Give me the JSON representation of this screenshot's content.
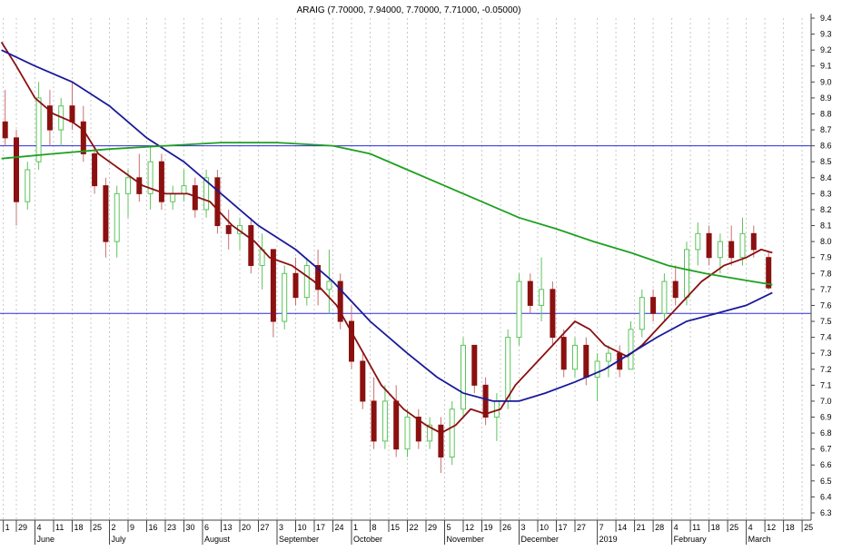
{
  "chart_data": {
    "type": "candlestick",
    "title": "ARAIG (7.70000, 7.94000, 7.70000, 7.71000, -0.05000)",
    "ylim": [
      6.3,
      9.4
    ],
    "y_ticks": [
      6.3,
      6.4,
      6.5,
      6.6,
      6.7,
      6.8,
      6.9,
      7.0,
      7.1,
      7.2,
      7.3,
      7.4,
      7.5,
      7.6,
      7.7,
      7.8,
      7.9,
      8.0,
      8.1,
      8.2,
      8.3,
      8.4,
      8.5,
      8.6,
      8.7,
      8.8,
      8.9,
      9.0,
      9.1,
      9.2,
      9.3,
      9.4
    ],
    "xlim_days": [
      -4,
      213
    ],
    "x_ticks": [
      {
        "d": -3.5,
        "label": "1"
      },
      {
        "d": 0,
        "label": "29"
      },
      {
        "d": 5,
        "label": "4"
      },
      {
        "d": 10,
        "label": "11"
      },
      {
        "d": 15,
        "label": "18"
      },
      {
        "d": 20,
        "label": "25"
      },
      {
        "d": 25,
        "label": "2"
      },
      {
        "d": 30,
        "label": "9"
      },
      {
        "d": 35,
        "label": "16"
      },
      {
        "d": 40,
        "label": "23"
      },
      {
        "d": 45,
        "label": "30"
      },
      {
        "d": 50,
        "label": "6"
      },
      {
        "d": 55,
        "label": "13"
      },
      {
        "d": 60,
        "label": "20"
      },
      {
        "d": 65,
        "label": "27"
      },
      {
        "d": 70,
        "label": "3"
      },
      {
        "d": 75,
        "label": "10"
      },
      {
        "d": 80,
        "label": "17"
      },
      {
        "d": 85,
        "label": "24"
      },
      {
        "d": 90,
        "label": "1"
      },
      {
        "d": 95,
        "label": "8"
      },
      {
        "d": 100,
        "label": "15"
      },
      {
        "d": 105,
        "label": "22"
      },
      {
        "d": 110,
        "label": "29"
      },
      {
        "d": 115,
        "label": "5"
      },
      {
        "d": 120,
        "label": "12"
      },
      {
        "d": 125,
        "label": "19"
      },
      {
        "d": 130,
        "label": "26"
      },
      {
        "d": 135,
        "label": "3"
      },
      {
        "d": 140,
        "label": "10"
      },
      {
        "d": 145,
        "label": "17"
      },
      {
        "d": 150,
        "label": "27"
      },
      {
        "d": 156,
        "label": "7"
      },
      {
        "d": 161,
        "label": "14"
      },
      {
        "d": 166,
        "label": "21"
      },
      {
        "d": 171,
        "label": "28"
      },
      {
        "d": 176,
        "label": "4"
      },
      {
        "d": 181,
        "label": "11"
      },
      {
        "d": 186,
        "label": "18"
      },
      {
        "d": 191,
        "label": "25"
      },
      {
        "d": 196,
        "label": "4"
      },
      {
        "d": 201,
        "label": "12"
      },
      {
        "d": 206,
        "label": "18"
      },
      {
        "d": 211,
        "label": "25"
      }
    ],
    "months": [
      {
        "d": 5,
        "label": "June"
      },
      {
        "d": 25,
        "label": "July"
      },
      {
        "d": 50,
        "label": "August"
      },
      {
        "d": 70,
        "label": "September"
      },
      {
        "d": 90,
        "label": "October"
      },
      {
        "d": 115,
        "label": "November"
      },
      {
        "d": 135,
        "label": "December"
      },
      {
        "d": 156,
        "label": "2019"
      },
      {
        "d": 176,
        "label": "February"
      },
      {
        "d": 196,
        "label": "March"
      }
    ],
    "horizontal_lines": [
      8.6,
      7.55
    ],
    "candles": [
      [
        -3,
        8.75,
        8.95,
        8.6,
        8.65
      ],
      [
        0,
        8.65,
        8.7,
        8.1,
        8.25
      ],
      [
        3,
        8.25,
        8.5,
        8.2,
        8.45
      ],
      [
        6,
        8.5,
        9.0,
        8.45,
        8.9
      ],
      [
        9,
        8.85,
        8.95,
        8.6,
        8.7
      ],
      [
        12,
        8.7,
        8.9,
        8.6,
        8.85
      ],
      [
        15,
        8.85,
        9.0,
        8.7,
        8.75
      ],
      [
        18,
        8.75,
        8.85,
        8.5,
        8.55
      ],
      [
        21,
        8.55,
        8.6,
        8.3,
        8.35
      ],
      [
        24,
        8.35,
        8.4,
        7.9,
        8.0
      ],
      [
        27,
        8.0,
        8.35,
        7.9,
        8.3
      ],
      [
        30,
        8.3,
        8.45,
        8.15,
        8.4
      ],
      [
        33,
        8.4,
        8.55,
        8.25,
        8.3
      ],
      [
        36,
        8.3,
        8.6,
        8.2,
        8.5
      ],
      [
        39,
        8.5,
        8.55,
        8.2,
        8.25
      ],
      [
        42,
        8.25,
        8.35,
        8.2,
        8.3
      ],
      [
        45,
        8.3,
        8.45,
        8.25,
        8.35
      ],
      [
        48,
        8.35,
        8.4,
        8.15,
        8.2
      ],
      [
        51,
        8.2,
        8.45,
        8.15,
        8.4
      ],
      [
        54,
        8.4,
        8.45,
        8.05,
        8.1
      ],
      [
        57,
        8.1,
        8.2,
        7.95,
        8.05
      ],
      [
        60,
        8.05,
        8.15,
        7.95,
        8.1
      ],
      [
        63,
        8.1,
        8.15,
        7.8,
        7.85
      ],
      [
        66,
        7.85,
        8.05,
        7.7,
        7.95
      ],
      [
        69,
        7.95,
        7.95,
        7.4,
        7.5
      ],
      [
        72,
        7.5,
        7.85,
        7.45,
        7.8
      ],
      [
        75,
        7.8,
        7.9,
        7.6,
        7.65
      ],
      [
        78,
        7.65,
        7.9,
        7.6,
        7.85
      ],
      [
        81,
        7.85,
        7.95,
        7.6,
        7.7
      ],
      [
        84,
        7.7,
        7.95,
        7.55,
        7.75
      ],
      [
        87,
        7.75,
        7.8,
        7.45,
        7.5
      ],
      [
        90,
        7.5,
        7.6,
        7.2,
        7.25
      ],
      [
        93,
        7.25,
        7.3,
        6.95,
        7.0
      ],
      [
        96,
        7.0,
        7.15,
        6.7,
        6.75
      ],
      [
        99,
        6.75,
        7.1,
        6.7,
        7.0
      ],
      [
        102,
        7.0,
        7.1,
        6.65,
        6.7
      ],
      [
        105,
        6.7,
        6.95,
        6.65,
        6.9
      ],
      [
        108,
        6.9,
        6.95,
        6.7,
        6.75
      ],
      [
        111,
        6.75,
        6.9,
        6.7,
        6.85
      ],
      [
        114,
        6.85,
        6.9,
        6.55,
        6.65
      ],
      [
        117,
        6.65,
        7.0,
        6.6,
        6.95
      ],
      [
        120,
        6.95,
        7.4,
        6.9,
        7.35
      ],
      [
        123,
        7.35,
        7.35,
        7.05,
        7.1
      ],
      [
        126,
        7.1,
        7.15,
        6.85,
        6.9
      ],
      [
        129,
        6.9,
        7.05,
        6.75,
        7.0
      ],
      [
        132,
        7.0,
        7.45,
        6.95,
        7.4
      ],
      [
        135,
        7.4,
        7.8,
        7.35,
        7.75
      ],
      [
        138,
        7.75,
        7.8,
        7.55,
        7.6
      ],
      [
        141,
        7.6,
        7.9,
        7.5,
        7.7
      ],
      [
        144,
        7.7,
        7.75,
        7.35,
        7.4
      ],
      [
        147,
        7.4,
        7.45,
        7.15,
        7.2
      ],
      [
        150,
        7.2,
        7.4,
        7.15,
        7.35
      ],
      [
        153,
        7.35,
        7.4,
        7.1,
        7.15
      ],
      [
        156,
        7.15,
        7.3,
        7.0,
        7.25
      ],
      [
        159,
        7.25,
        7.35,
        7.15,
        7.3
      ],
      [
        162,
        7.3,
        7.35,
        7.15,
        7.2
      ],
      [
        165,
        7.2,
        7.5,
        7.2,
        7.45
      ],
      [
        168,
        7.45,
        7.7,
        7.4,
        7.65
      ],
      [
        171,
        7.65,
        7.7,
        7.5,
        7.55
      ],
      [
        174,
        7.55,
        7.8,
        7.5,
        7.75
      ],
      [
        177,
        7.75,
        7.85,
        7.6,
        7.65
      ],
      [
        180,
        7.65,
        8.0,
        7.6,
        7.95
      ],
      [
        183,
        7.95,
        8.12,
        7.85,
        8.05
      ],
      [
        186,
        8.05,
        8.1,
        7.85,
        7.9
      ],
      [
        189,
        7.9,
        8.05,
        7.8,
        8.0
      ],
      [
        192,
        8.0,
        8.1,
        7.85,
        7.9
      ],
      [
        195,
        7.9,
        8.15,
        7.85,
        8.05
      ],
      [
        198,
        8.05,
        8.1,
        7.9,
        7.95
      ],
      [
        202,
        7.9,
        7.94,
        7.7,
        7.71
      ]
    ],
    "series": [
      {
        "name": "short-ma",
        "color": "#8b1010",
        "points": [
          [
            -4,
            9.25
          ],
          [
            0,
            9.1
          ],
          [
            5,
            8.9
          ],
          [
            10,
            8.8
          ],
          [
            15,
            8.75
          ],
          [
            18,
            8.7
          ],
          [
            22,
            8.55
          ],
          [
            28,
            8.45
          ],
          [
            34,
            8.35
          ],
          [
            40,
            8.3
          ],
          [
            46,
            8.3
          ],
          [
            52,
            8.25
          ],
          [
            58,
            8.1
          ],
          [
            64,
            8.0
          ],
          [
            68,
            7.9
          ],
          [
            74,
            7.85
          ],
          [
            80,
            7.75
          ],
          [
            86,
            7.6
          ],
          [
            92,
            7.35
          ],
          [
            98,
            7.1
          ],
          [
            104,
            6.95
          ],
          [
            110,
            6.85
          ],
          [
            114,
            6.8
          ],
          [
            118,
            6.85
          ],
          [
            122,
            6.95
          ],
          [
            126,
            6.92
          ],
          [
            130,
            6.95
          ],
          [
            134,
            7.1
          ],
          [
            140,
            7.25
          ],
          [
            146,
            7.4
          ],
          [
            150,
            7.5
          ],
          [
            154,
            7.45
          ],
          [
            158,
            7.35
          ],
          [
            164,
            7.28
          ],
          [
            168,
            7.35
          ],
          [
            172,
            7.45
          ],
          [
            178,
            7.6
          ],
          [
            184,
            7.75
          ],
          [
            190,
            7.85
          ],
          [
            196,
            7.9
          ],
          [
            200,
            7.95
          ],
          [
            203,
            7.93
          ]
        ]
      },
      {
        "name": "mid-ma",
        "color": "#1a1a9a",
        "points": [
          [
            -4,
            9.2
          ],
          [
            5,
            9.1
          ],
          [
            15,
            9.0
          ],
          [
            25,
            8.85
          ],
          [
            35,
            8.65
          ],
          [
            45,
            8.5
          ],
          [
            55,
            8.3
          ],
          [
            65,
            8.1
          ],
          [
            75,
            7.95
          ],
          [
            85,
            7.75
          ],
          [
            95,
            7.5
          ],
          [
            105,
            7.3
          ],
          [
            113,
            7.15
          ],
          [
            120,
            7.05
          ],
          [
            128,
            7.0
          ],
          [
            135,
            7.0
          ],
          [
            142,
            7.05
          ],
          [
            150,
            7.12
          ],
          [
            158,
            7.2
          ],
          [
            165,
            7.3
          ],
          [
            172,
            7.4
          ],
          [
            180,
            7.5
          ],
          [
            188,
            7.55
          ],
          [
            196,
            7.6
          ],
          [
            203,
            7.68
          ]
        ]
      },
      {
        "name": "long-ma",
        "color": "#1fa01f",
        "points": [
          [
            -4,
            8.52
          ],
          [
            10,
            8.55
          ],
          [
            25,
            8.58
          ],
          [
            40,
            8.6
          ],
          [
            55,
            8.62
          ],
          [
            70,
            8.62
          ],
          [
            85,
            8.6
          ],
          [
            95,
            8.55
          ],
          [
            105,
            8.45
          ],
          [
            115,
            8.35
          ],
          [
            125,
            8.25
          ],
          [
            135,
            8.15
          ],
          [
            145,
            8.08
          ],
          [
            155,
            8.0
          ],
          [
            165,
            7.93
          ],
          [
            175,
            7.85
          ],
          [
            185,
            7.8
          ],
          [
            195,
            7.76
          ],
          [
            203,
            7.73
          ]
        ]
      }
    ],
    "colors": {
      "up": "#5cc45c",
      "down": "#8b1010",
      "hline": "#2a2ae0",
      "grid": "#c8c8c8"
    }
  }
}
